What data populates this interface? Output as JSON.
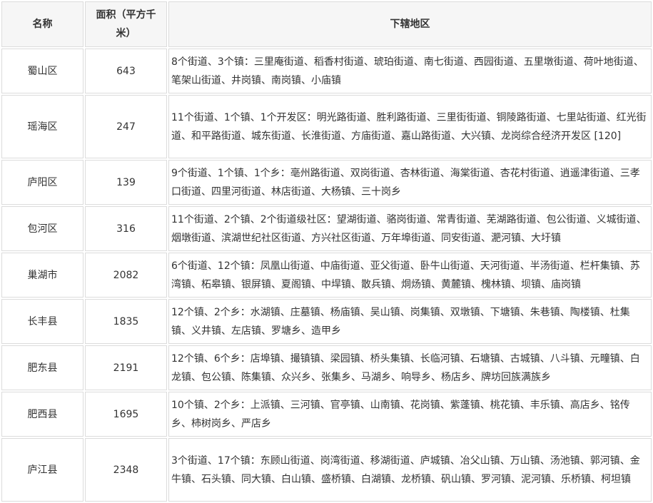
{
  "table": {
    "headers": {
      "name": "名称",
      "area": "面积（平方千米）",
      "districts": "下辖地区"
    },
    "rows": [
      {
        "name": "蜀山区",
        "area": "643",
        "districts": "8个街道、3个镇：三里庵街道、稻香村街道、琥珀街道、南七街道、西园街道、五里墩街道、荷叶地街道、笔架山街道、井岗镇、南岗镇、小庙镇"
      },
      {
        "name": "瑶海区",
        "area": "247",
        "districts": "11个街道、1个镇、1个开发区：明光路街道、胜利路街道、三里街街道、铜陵路街道、七里站街道、红光街道、和平路街道、城东街道、长淮街道、方庙街道、嘉山路街道、大兴镇、龙岗综合经济开发区 [120]"
      },
      {
        "name": "庐阳区",
        "area": "139",
        "districts": "9个街道、1个镇、1个乡：亳州路街道、双岗街道、杏林街道、海棠街道、杏花村街道、逍遥津街道、三孝口街道、四里河街道、林店街道、大杨镇、三十岗乡"
      },
      {
        "name": "包河区",
        "area": "316",
        "districts": "11个街道、2个镇、2个街道级社区：望湖街道、骆岗街道、常青街道、芜湖路街道、包公街道、义城街道、烟墩街道、滨湖世纪社区街道、方兴社区街道、万年埠街道、同安街道、淝河镇、大圩镇"
      },
      {
        "name": "巢湖市",
        "area": "2082",
        "districts": "6个街道、12个镇：凤凰山街道、中庙街道、亚父街道、卧牛山街道、天河街道、半汤街道、栏杆集镇、苏湾镇、柘皋镇、银屏镇、夏阁镇、中垾镇、散兵镇、烔炀镇、黄麓镇、槐林镇、坝镇、庙岗镇"
      },
      {
        "name": "长丰县",
        "area": "1835",
        "districts": "12个镇、2个乡：水湖镇、庄墓镇、杨庙镇、吴山镇、岗集镇、双墩镇、下塘镇、朱巷镇、陶楼镇、杜集镇、义井镇、左店镇、罗塘乡、造甲乡"
      },
      {
        "name": "肥东县",
        "area": "2191",
        "districts": "12个镇、6个乡：店埠镇、撮镇镇、梁园镇、桥头集镇、长临河镇、石塘镇、古城镇、八斗镇、元疃镇、白龙镇、包公镇、陈集镇、众兴乡、张集乡、马湖乡、响导乡、杨店乡、牌坊回族满族乡"
      },
      {
        "name": "肥西县",
        "area": "1695",
        "districts": "10个镇、2个乡：上派镇、三河镇、官亭镇、山南镇、花岗镇、紫蓬镇、桃花镇、丰乐镇、高店乡、铭传乡、柿树岗乡、严店乡"
      },
      {
        "name": "庐江县",
        "area": "2348",
        "districts": "3个街道、17个镇：东顾山街道、岗湾街道、移湖街道、庐城镇、冶父山镇、万山镇、汤池镇、郭河镇、金牛镇、石头镇、同大镇、白山镇、盛桥镇、白湖镇、龙桥镇、矾山镇、罗河镇、泥河镇、乐桥镇、柯坦镇"
      }
    ]
  }
}
